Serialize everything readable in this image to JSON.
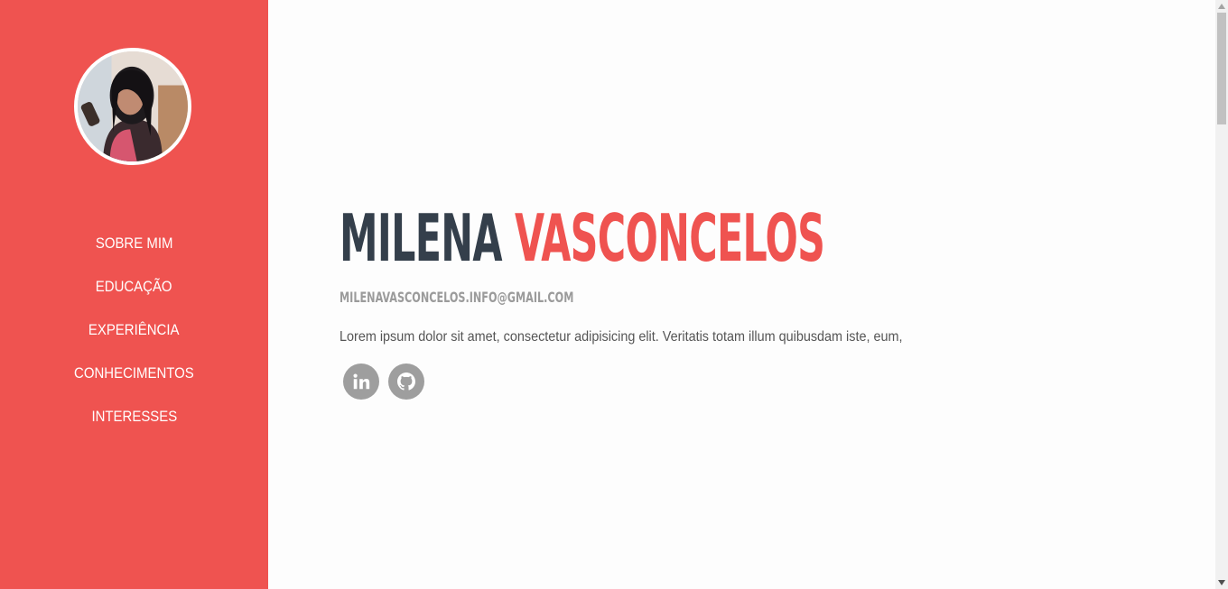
{
  "sidebar": {
    "nav": [
      {
        "label": "SOBRE MIM"
      },
      {
        "label": "EDUCAÇÃO"
      },
      {
        "label": "EXPERIÊNCIA"
      },
      {
        "label": "CONHECIMENTOS"
      },
      {
        "label": "INTERESSES"
      }
    ]
  },
  "profile": {
    "first_name": "MILENA",
    "last_name": "VASCONCELOS",
    "email": "MILENAVASCONCELOS.INFO@GMAIL.COM",
    "bio": "Lorem ipsum dolor sit amet, consectetur adipisicing elit. Veritatis totam illum quibusdam iste, eum,"
  },
  "social": [
    {
      "icon": "linkedin-icon"
    },
    {
      "icon": "github-icon"
    }
  ],
  "colors": {
    "accent": "#ef5350",
    "heading": "#343f4b",
    "muted": "#9b9b9b",
    "social_bg": "#9e9e9e"
  }
}
